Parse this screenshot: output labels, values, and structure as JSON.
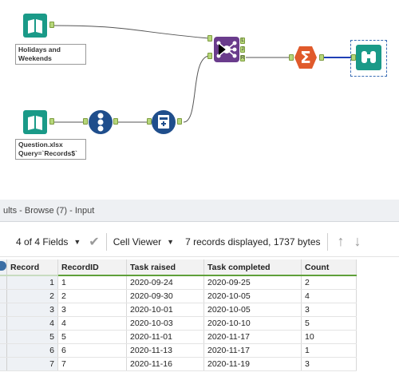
{
  "canvas": {
    "tools": {
      "holidays_input": {
        "label_line1": "Holidays and",
        "label_line2": "Weekends"
      },
      "question_input": {
        "label_line1": "Question.xlsx",
        "label_line2": "Query=`Records$`"
      },
      "record_id": {
        "glyphs": [
          "1",
          "2",
          "3"
        ]
      },
      "join": {
        "anchors": [
          "L",
          "J",
          "R"
        ]
      },
      "summarize": {
        "glyph": "Σ"
      },
      "formula": {},
      "browse": {}
    },
    "colors": {
      "input_teal": "#1a9a88",
      "record_blue": "#1f4e8c",
      "join_purple": "#6a3c8c",
      "summarize_orange": "#e05a2b",
      "anchor_green": "#b6d77a",
      "wire": "#555555",
      "wire_selected": "#1f3fb5"
    }
  },
  "results": {
    "title": "ults - Browse (7) - Input",
    "toolbar": {
      "fields": "4 of 4 Fields",
      "cell_viewer": "Cell Viewer",
      "records_info": "7 records displayed, 1737 bytes",
      "up_arrow": "↑",
      "down_arrow": "↓",
      "check": "✔"
    },
    "table": {
      "columns": [
        "Record",
        "RecordID",
        "Task raised",
        "Task completed",
        "Count"
      ],
      "rows": [
        [
          "1",
          "1",
          "2020-09-24",
          "2020-09-25",
          "2"
        ],
        [
          "2",
          "2",
          "2020-09-30",
          "2020-10-05",
          "4"
        ],
        [
          "3",
          "3",
          "2020-10-01",
          "2020-10-05",
          "3"
        ],
        [
          "4",
          "4",
          "2020-10-03",
          "2020-10-10",
          "5"
        ],
        [
          "5",
          "5",
          "2020-11-01",
          "2020-11-17",
          "10"
        ],
        [
          "6",
          "6",
          "2020-11-13",
          "2020-11-17",
          "1"
        ],
        [
          "7",
          "7",
          "2020-11-16",
          "2020-11-19",
          "3"
        ]
      ]
    }
  }
}
